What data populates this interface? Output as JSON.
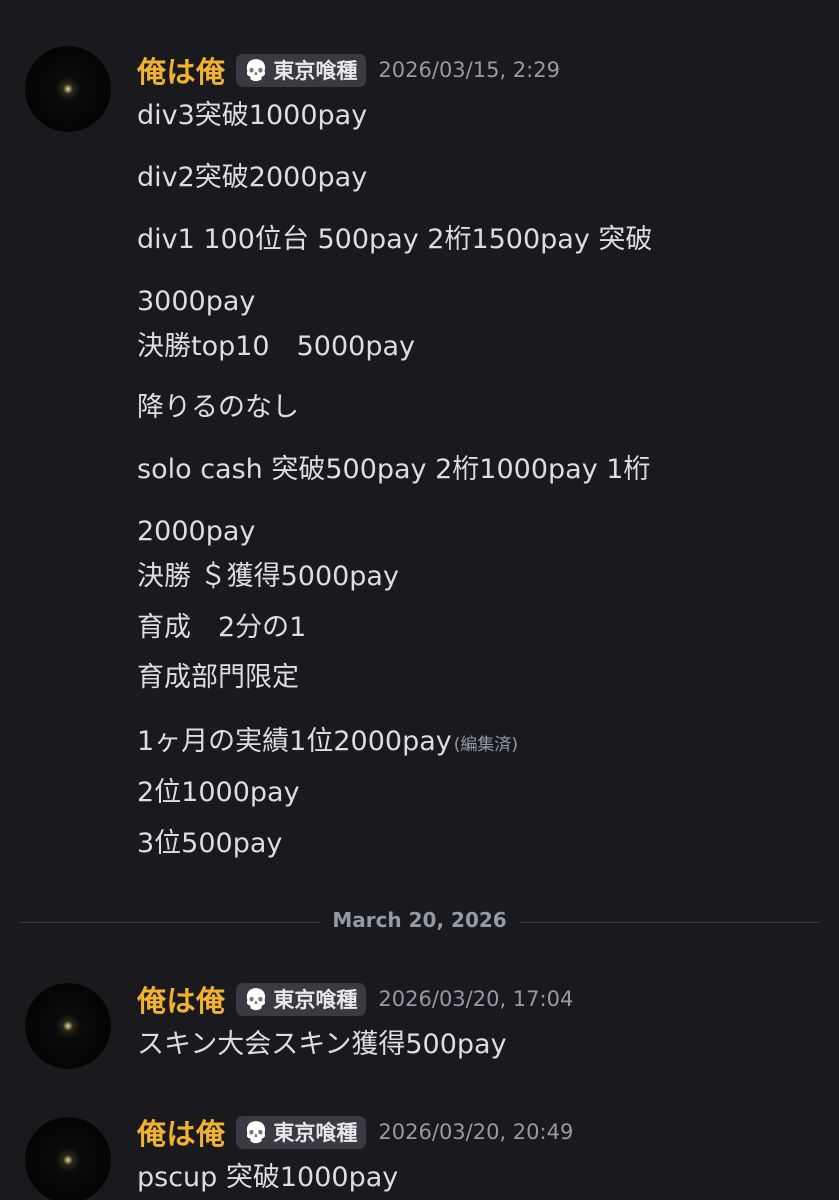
{
  "messages": [
    {
      "username": "俺は俺",
      "tag": "東京喰種",
      "timestamp": "2026/03/15, 2:29",
      "lines": [
        "div3突破1000pay",
        "div2突破2000pay",
        "div1 100位台 500pay 2桁1500pay 突破",
        "3000pay",
        "決勝top10　5000pay",
        "降りるのなし",
        "solo cash  突破500pay 2桁1000pay 1桁",
        "2000pay",
        "決勝 ＄獲得5000pay",
        "育成　2分の1",
        "育成部門限定",
        "1ヶ月の実績1位2000pay",
        "2位1000pay",
        "3位500pay"
      ],
      "edited_label": "(編集済)"
    },
    {
      "username": "俺は俺",
      "tag": "東京喰種",
      "timestamp": "2026/03/20, 17:04",
      "lines": [
        "スキン大会スキン獲得500pay"
      ]
    },
    {
      "username": "俺は俺",
      "tag": "東京喰種",
      "timestamp": "2026/03/20, 20:49",
      "lines": [
        "pscup 突破1000pay"
      ]
    }
  ],
  "date_divider": "March 20, 2026",
  "icons": {
    "tag_icon": "skull-icon"
  },
  "colors": {
    "background": "#1a1a1e",
    "username": "#f0b232",
    "text": "#dbdee1",
    "muted": "#949ba4",
    "tag_bg": "#3a3b42"
  }
}
